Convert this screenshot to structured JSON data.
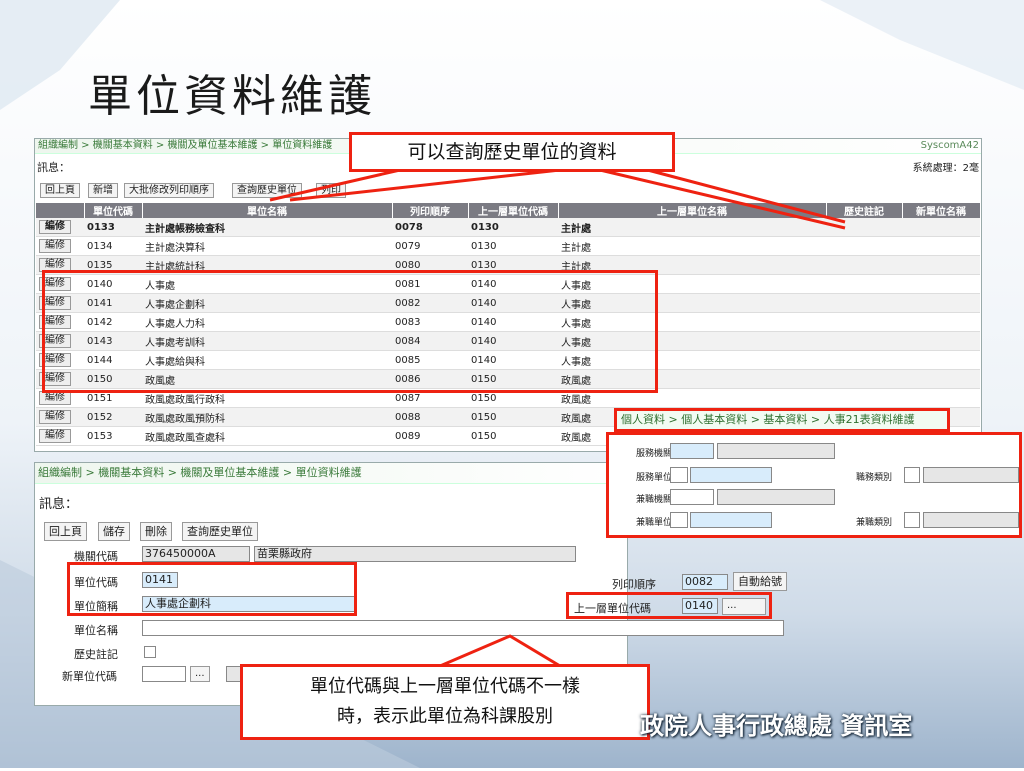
{
  "slide_title": "單位資料維護",
  "top_window": {
    "breadcrumb": "組織編制 > 機關基本資料 > 機關及單位基本維護 > 單位資料維護",
    "system_label": "SyscomA42",
    "message_label": "訊息：",
    "process_label": "系統處理：2毫",
    "buttons": [
      "回上頁",
      "新增",
      "大批修改列印順序",
      "查詢歷史單位",
      "列印"
    ],
    "columns": [
      "",
      "單位代碼",
      "單位名稱",
      "列印順序",
      "上一層單位代碼",
      "上一層單位名稱",
      "歷史註記",
      "新單位名稱"
    ],
    "edit_label": "編修",
    "rows": [
      {
        "code": "0133",
        "name": "主計處帳務檢查科",
        "order": "0078",
        "parent_code": "0130",
        "parent_name": "主計處"
      },
      {
        "code": "0134",
        "name": "主計處決算科",
        "order": "0079",
        "parent_code": "0130",
        "parent_name": "主計處"
      },
      {
        "code": "0135",
        "name": "主計處統計科",
        "order": "0080",
        "parent_code": "0130",
        "parent_name": "主計處"
      },
      {
        "code": "0140",
        "name": "人事處",
        "order": "0081",
        "parent_code": "0140",
        "parent_name": "人事處"
      },
      {
        "code": "0141",
        "name": "人事處企劃科",
        "order": "0082",
        "parent_code": "0140",
        "parent_name": "人事處"
      },
      {
        "code": "0142",
        "name": "人事處人力科",
        "order": "0083",
        "parent_code": "0140",
        "parent_name": "人事處"
      },
      {
        "code": "0143",
        "name": "人事處考訓科",
        "order": "0084",
        "parent_code": "0140",
        "parent_name": "人事處"
      },
      {
        "code": "0144",
        "name": "人事處給與科",
        "order": "0085",
        "parent_code": "0140",
        "parent_name": "人事處"
      },
      {
        "code": "0150",
        "name": "政風處",
        "order": "0086",
        "parent_code": "0150",
        "parent_name": "政風處"
      },
      {
        "code": "0151",
        "name": "政風處政風行政科",
        "order": "0087",
        "parent_code": "0150",
        "parent_name": "政風處"
      },
      {
        "code": "0152",
        "name": "政風處政風預防科",
        "order": "0088",
        "parent_code": "0150",
        "parent_name": "政風處"
      },
      {
        "code": "0153",
        "name": "政風處政風查處科",
        "order": "0089",
        "parent_code": "0150",
        "parent_name": "政風處"
      }
    ]
  },
  "callout_top": "可以查詢歷史單位的資料",
  "bottom_window": {
    "breadcrumb": "組織編制 > 機關基本資料 > 機關及單位基本維護 > 單位資料維護",
    "message_label": "訊息：",
    "buttons": [
      "回上頁",
      "儲存",
      "刪除",
      "查詢歷史單位"
    ],
    "agency_code_label": "機關代碼",
    "agency_code": "376450000A",
    "agency_name": "苗栗縣政府",
    "unit_code_label": "單位代碼",
    "unit_code": "0141",
    "unit_short_label": "單位簡稱",
    "unit_short": "人事處企劃科",
    "unit_name_label": "單位名稱",
    "unit_name": "",
    "history_label": "歷史註記",
    "new_code_label": "新單位代碼",
    "print_order_label": "列印順序",
    "print_order": "0082",
    "auto_number_button": "自動給號",
    "parent_code_label": "上一層單位代碼",
    "parent_code": "0140",
    "browse_button": "..."
  },
  "right_panel": {
    "breadcrumb": "個人資料 > 個人基本資料 > 基本資料 > 人事21表資料維護",
    "labels": [
      "服務機關",
      "服務單位",
      "兼職機關",
      "兼職單位"
    ],
    "right_labels": [
      "職務類別",
      "兼職類別"
    ]
  },
  "callout_bottom": [
    "單位代碼與上一層單位代碼不一樣",
    "時，表示此單位為科課股別"
  ],
  "footer_text": "政院人事行政總處 資訊室"
}
